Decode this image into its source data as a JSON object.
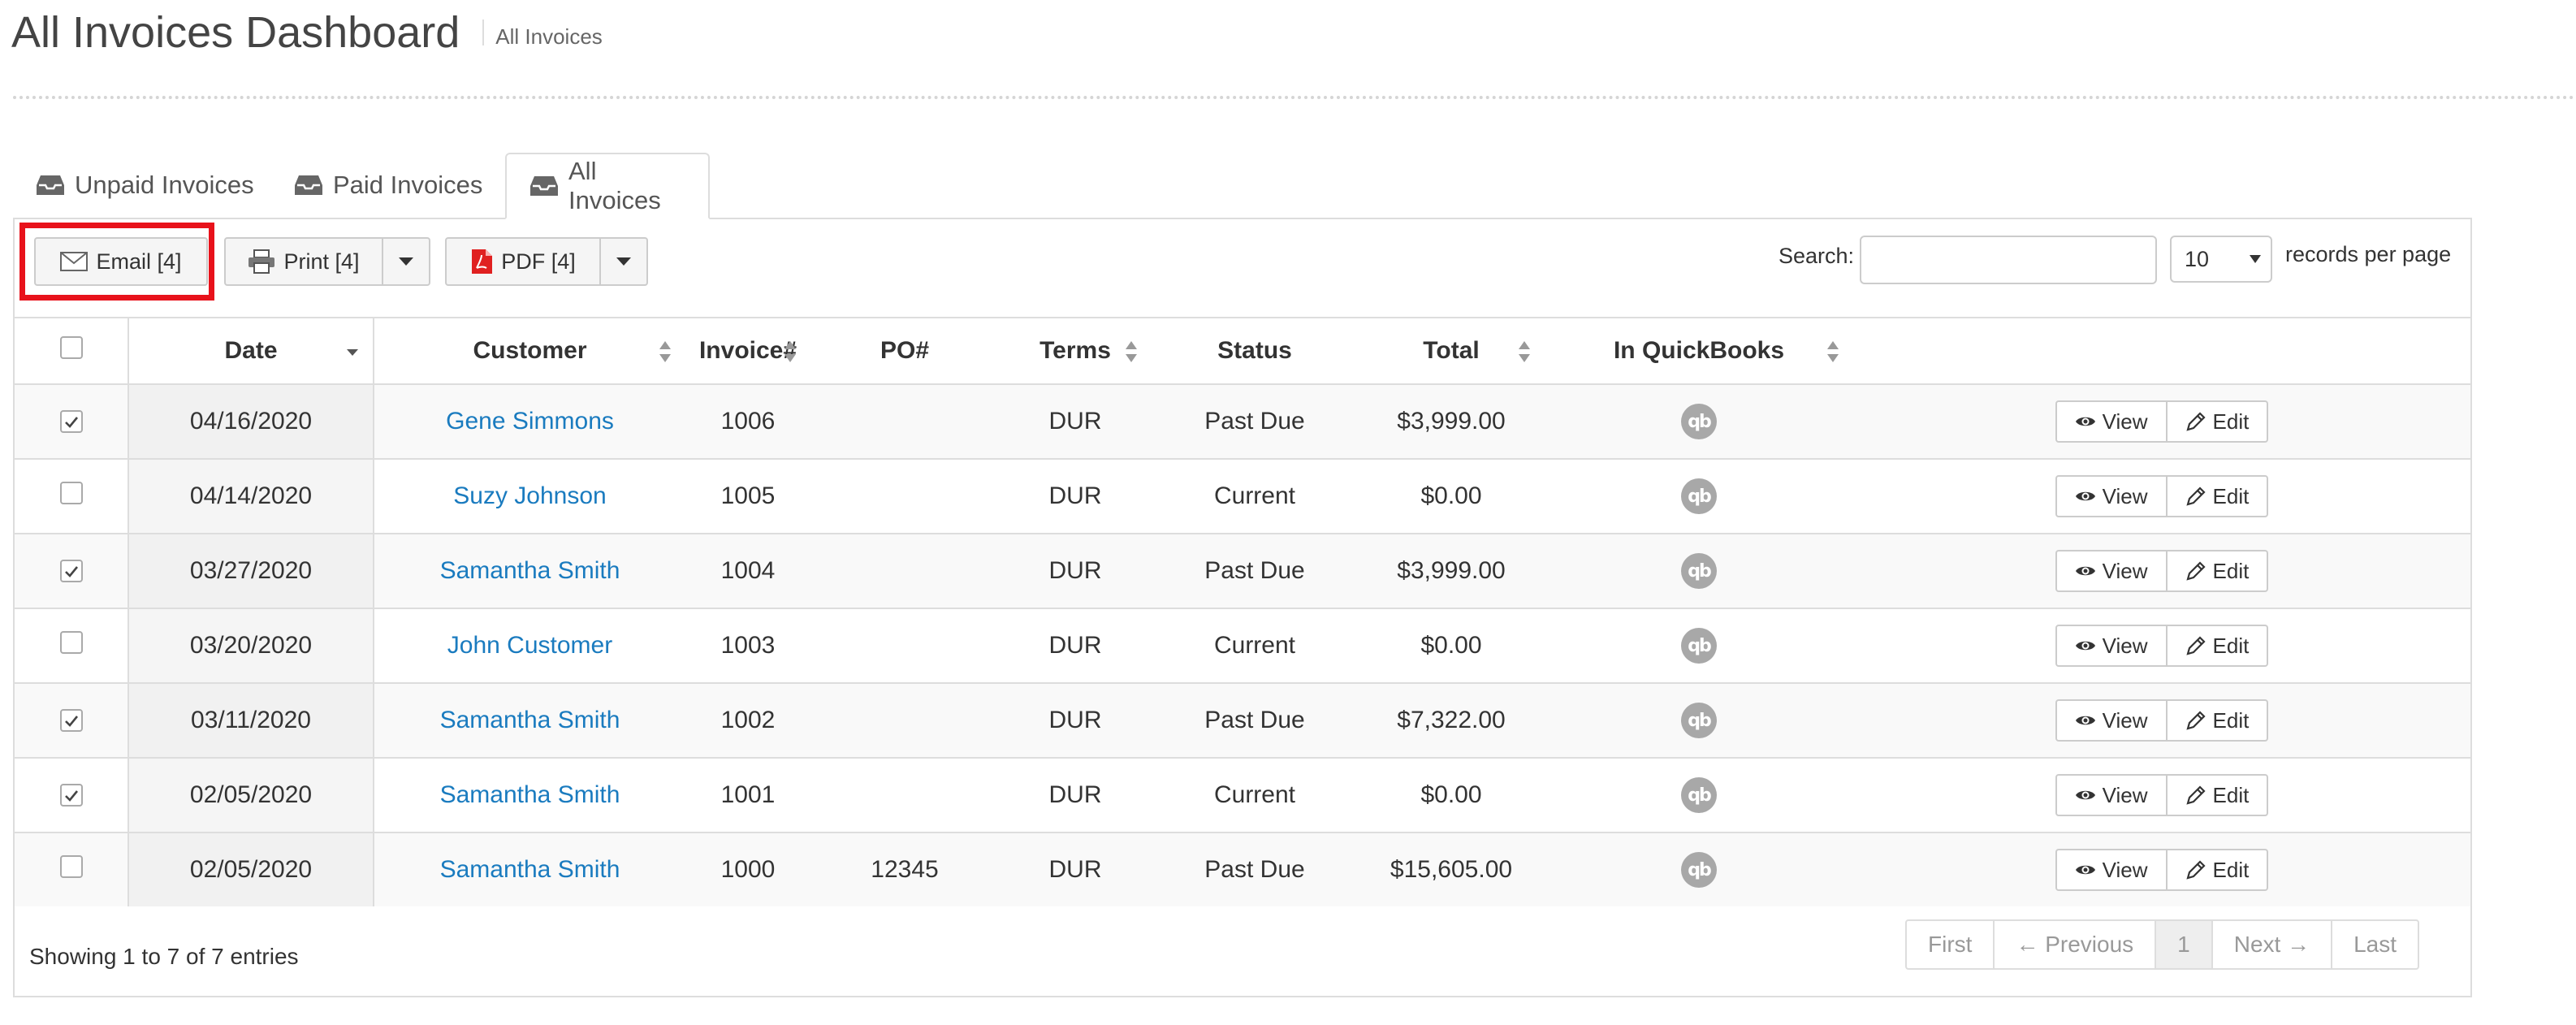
{
  "header": {
    "title": "All Invoices Dashboard",
    "breadcrumb": "All Invoices"
  },
  "tabs": [
    {
      "label": "Unpaid Invoices",
      "active": false
    },
    {
      "label": "Paid Invoices",
      "active": false
    },
    {
      "label": "All Invoices",
      "active": true
    }
  ],
  "toolbar": {
    "email_label": "Email [4]",
    "print_label": "Print [4]",
    "pdf_label": "PDF [4]",
    "search_label": "Search:",
    "search_value": "",
    "records_value": "10",
    "records_label": "records per page",
    "highlight_color": "#e8121b"
  },
  "columns": [
    "Date",
    "Customer",
    "Invoice#",
    "PO#",
    "Terms",
    "Status",
    "Total",
    "In QuickBooks"
  ],
  "rows": [
    {
      "checked": true,
      "date": "04/16/2020",
      "customer": "Gene Simmons",
      "invoice": "1006",
      "po": "",
      "terms": "DUR",
      "status": "Past Due",
      "total": "$3,999.00"
    },
    {
      "checked": false,
      "date": "04/14/2020",
      "customer": "Suzy Johnson",
      "invoice": "1005",
      "po": "",
      "terms": "DUR",
      "status": "Current",
      "total": "$0.00"
    },
    {
      "checked": true,
      "date": "03/27/2020",
      "customer": "Samantha Smith",
      "invoice": "1004",
      "po": "",
      "terms": "DUR",
      "status": "Past Due",
      "total": "$3,999.00"
    },
    {
      "checked": false,
      "date": "03/20/2020",
      "customer": "John Customer",
      "invoice": "1003",
      "po": "",
      "terms": "DUR",
      "status": "Current",
      "total": "$0.00"
    },
    {
      "checked": true,
      "date": "03/11/2020",
      "customer": "Samantha Smith",
      "invoice": "1002",
      "po": "",
      "terms": "DUR",
      "status": "Past Due",
      "total": "$7,322.00"
    },
    {
      "checked": true,
      "date": "02/05/2020",
      "customer": "Samantha Smith",
      "invoice": "1001",
      "po": "",
      "terms": "DUR",
      "status": "Current",
      "total": "$0.00"
    },
    {
      "checked": false,
      "date": "02/05/2020",
      "customer": "Samantha Smith",
      "invoice": "1000",
      "po": "12345",
      "terms": "DUR",
      "status": "Past Due",
      "total": "$15,605.00"
    }
  ],
  "row_actions": {
    "view_label": "View",
    "edit_label": "Edit",
    "qb_icon_text": "qb"
  },
  "footer": {
    "info": "Showing 1 to 7 of 7 entries",
    "pager": {
      "first": "First",
      "previous": "← Previous",
      "current": "1",
      "next": "Next →",
      "last": "Last"
    }
  },
  "colors": {
    "link": "#1a7bbf",
    "qb_icon": "#a8a8a8",
    "border": "#dddddd"
  }
}
